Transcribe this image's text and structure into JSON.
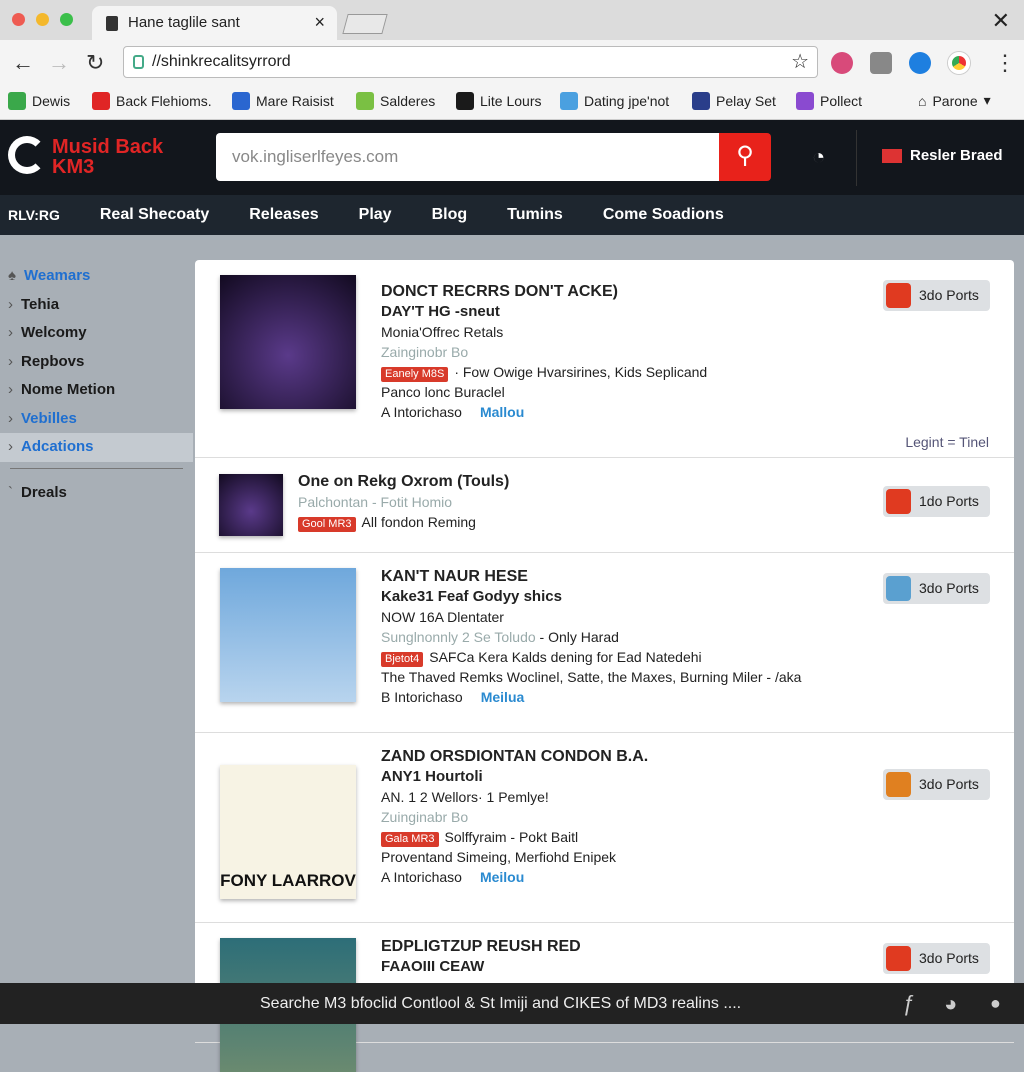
{
  "browser": {
    "tab_title": "Hane taglile sant",
    "url": "//shinkrecalitsyrrord",
    "bookmarks": [
      {
        "label": "Dewis",
        "color": "#3aa84a"
      },
      {
        "label": "Back Flehioms.",
        "color": "#e02525"
      },
      {
        "label": "Mare Raisist",
        "color": "#2a66d0"
      },
      {
        "label": "Salderes",
        "color": "#7ac043"
      },
      {
        "label": "Lite Lours",
        "color": "#1a1a1a"
      },
      {
        "label": "Dating jpe'not",
        "color": "#4aa0e0"
      },
      {
        "label": "Pelay Set",
        "color": "#2a3e8a"
      },
      {
        "label": "Pollect",
        "color": "#8a4ad0"
      }
    ],
    "profile_label": "Parone"
  },
  "site": {
    "logo": "Musid Back KM3",
    "search_value": "vok.ingliserlfeyes.com",
    "register_label": "Resler Braed",
    "nav": [
      "RLV:RG",
      "Real Shecoaty",
      "Releases",
      "Play",
      "Blog",
      "Tumins",
      "Come Soadions"
    ]
  },
  "sidebar": {
    "items": [
      {
        "label": "Weamars",
        "style": "blue"
      },
      {
        "label": "Tehia"
      },
      {
        "label": "Welcomy"
      },
      {
        "label": "Repbovs"
      },
      {
        "label": "Nome Metion"
      },
      {
        "label": "Vebilles",
        "style": "blue"
      },
      {
        "label": "Adcations",
        "style": "blue sel"
      }
    ],
    "extra": "Dreals"
  },
  "accent": "#e8221b",
  "items": [
    {
      "title": "DONCT RECRRS DON'T ACKE)",
      "subtitle": "DAY'T HG -sneut",
      "lines": [
        "Monia'Offrec Retals"
      ],
      "muted": "Zainginobr Bo",
      "badge": "Eanely M8S",
      "badge_text": "· Fow Owige Hvarsirines, Kids Seplicand",
      "line2": "Panco lonc Buraclel",
      "by": "A Intorichaso",
      "link": "Mallou",
      "button": "3do Ports",
      "btn_icon": "#e03a20",
      "legit": "Legint = Tinel",
      "cover": "dark"
    },
    {
      "title": "One on Rekg Oxrom (Touls)",
      "muted": "Palchontan - Fotit Homio",
      "badge": "Gool MR3",
      "badge_text": "All fondon Reming",
      "button": "1do Ports",
      "btn_icon": "#e03a20",
      "cover": "dark",
      "small": true
    },
    {
      "title": "KAN'T NAUR HESE",
      "subtitle": "Kake31 Feaf Godyy shics",
      "lines": [
        "NOW 16A Dlentater"
      ],
      "muted": "Sunglnonnly 2 Se Toludo",
      "muted_suffix": " - Only Harad",
      "badge": "Bjetot4",
      "badge_text": "SAFCa Kera Kalds dening for Ead Natedehi",
      "line2": "The Thaved Remks Woclinel, Satte, the Maxes, Burning Miler - /aka",
      "by": "B Intorichaso",
      "link": "Meilua",
      "button": "3do Ports",
      "btn_icon": "#5aa0d0",
      "cover": "portrait"
    },
    {
      "title": "ZAND ORSDIONTAN CONDON B.A.",
      "subtitle": "ANY1 Hourtoli",
      "lines": [
        "AN. 1 2 Wellors· 1 Pemlye!"
      ],
      "muted": "Zuinginabr Bo",
      "badge": "Gala MR3",
      "badge_text": "Solffyraim - Pokt Baitl",
      "line2": "Proventand Simeing, Merfiohd Enipek",
      "by": "A Intorichaso",
      "link": "Meilou",
      "button": "3do Ports",
      "btn_icon": "#e08020",
      "cover": "poster",
      "cover_text": "FONY LAARROV"
    },
    {
      "title": "EDPLIGTZUP REUSH RED",
      "subtitle": "FAAOIII CEAW",
      "button": "3do Ports",
      "btn_icon": "#e03a20",
      "cover": "group"
    }
  ],
  "footer": {
    "text": "Searche M3 bfoclid Contlool & St Imiji and CIKES of MD3 realins ...."
  }
}
